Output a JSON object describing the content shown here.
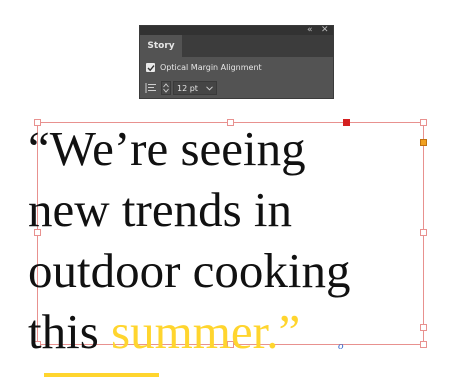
{
  "panel": {
    "tab_label": "Story",
    "collapse_glyph": "«",
    "close_glyph": "✕",
    "optical_margin_label": "Optical Margin Alignment",
    "optical_margin_checked": true,
    "size_value": "12 pt",
    "size_icon": "margin-alignment-icon"
  },
  "story": {
    "line1": "“We’re seeing",
    "line2": "new trends in",
    "line3": "outdoor cooking",
    "line4_plain": "this ",
    "line4_highlight": "summer.",
    "line4_end": "”"
  },
  "colors": {
    "panel_bg": "#535353",
    "frame_border": "#e8918f",
    "highlight": "#ffd52e",
    "text": "#111111",
    "overflow_port": "#f0a020",
    "handle_selected": "#d42020"
  }
}
